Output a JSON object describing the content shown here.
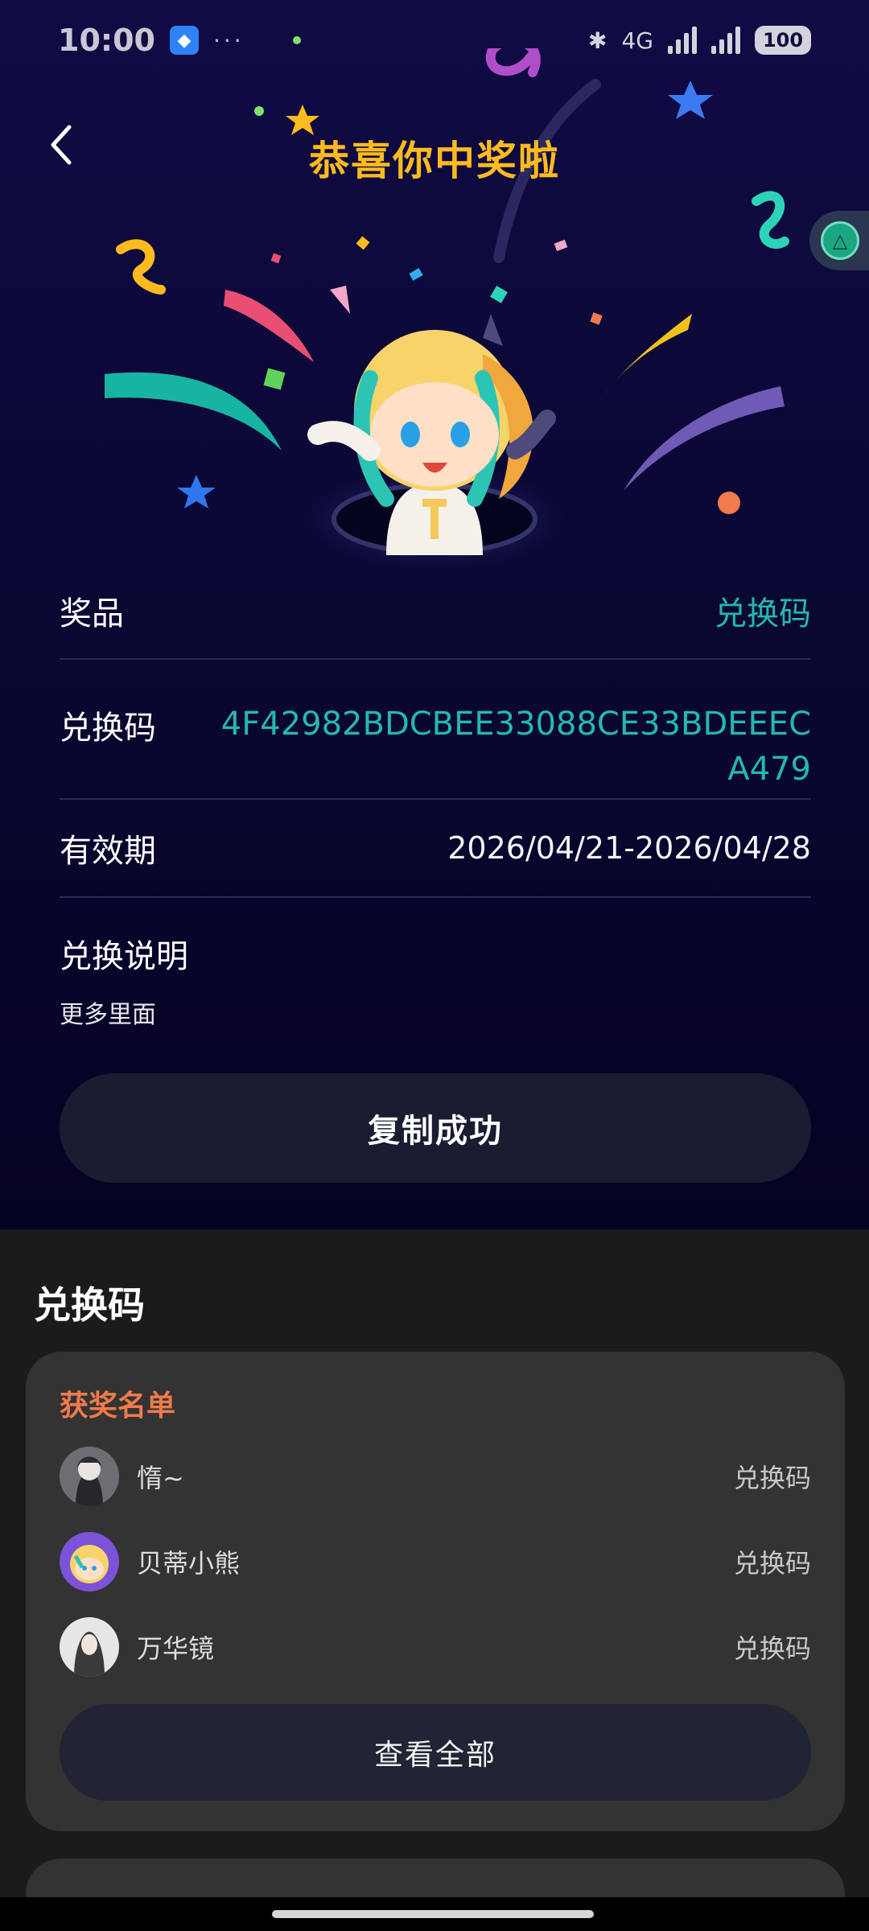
{
  "status_bar": {
    "time": "10:00",
    "dots": "···",
    "network": "4G",
    "battery": "100"
  },
  "header": {
    "title": "恭喜你中奖啦"
  },
  "prize": {
    "rows": [
      {
        "label": "奖品",
        "value": "兑换码"
      },
      {
        "label": "兑换码",
        "value": "4F42982BDCBEE33088CE33BDEEECA479"
      },
      {
        "label": "有效期",
        "value": "2026/04/21-2026/04/28"
      }
    ],
    "note_label": "兑换说明",
    "note_desc": "更多里面",
    "copy_button": "复制成功"
  },
  "section": {
    "title": "兑换码"
  },
  "winners": {
    "title": "获奖名单",
    "items": [
      {
        "name": "惰~",
        "prize": "兑换码"
      },
      {
        "name": "贝蒂小熊",
        "prize": "兑换码"
      },
      {
        "name": "万华镜",
        "prize": "兑换码"
      }
    ],
    "view_all": "查看全部"
  },
  "next_card": {
    "left": "",
    "right": ""
  },
  "colors": {
    "title_gold": "#ffbb1e",
    "accent_teal": "#23b8b0",
    "winners_orange": "#f07b4b",
    "page_bg_top": "#0b0836",
    "page_bg_bottom": "#1b1b1b"
  }
}
